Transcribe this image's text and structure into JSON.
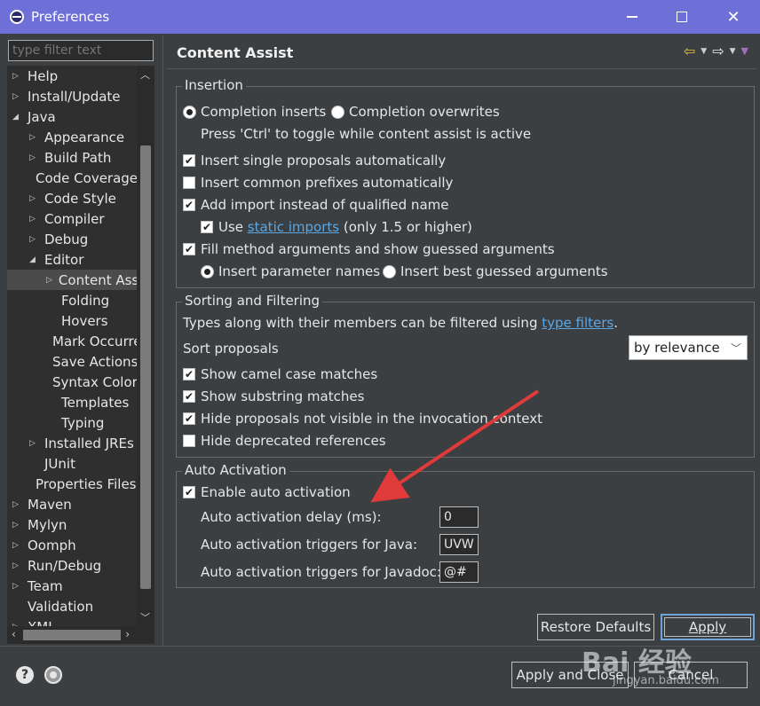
{
  "window": {
    "title": "Preferences"
  },
  "sidebar": {
    "filter_placeholder": "type filter text",
    "items": [
      {
        "label": "Help",
        "twisty": "▷"
      },
      {
        "label": "Install/Update",
        "twisty": "▷"
      },
      {
        "label": "Java",
        "twisty": "◢"
      },
      {
        "label": "Appearance",
        "twisty": "▷"
      },
      {
        "label": "Build Path",
        "twisty": "▷"
      },
      {
        "label": "Code Coverage",
        "twisty": ""
      },
      {
        "label": "Code Style",
        "twisty": "▷"
      },
      {
        "label": "Compiler",
        "twisty": "▷"
      },
      {
        "label": "Debug",
        "twisty": "▷"
      },
      {
        "label": "Editor",
        "twisty": "◢"
      },
      {
        "label": "Content Assist",
        "twisty": "▷"
      },
      {
        "label": "Folding",
        "twisty": ""
      },
      {
        "label": "Hovers",
        "twisty": ""
      },
      {
        "label": "Mark Occurrences",
        "twisty": ""
      },
      {
        "label": "Save Actions",
        "twisty": ""
      },
      {
        "label": "Syntax Coloring",
        "twisty": ""
      },
      {
        "label": "Templates",
        "twisty": ""
      },
      {
        "label": "Typing",
        "twisty": ""
      },
      {
        "label": "Installed JREs",
        "twisty": "▷"
      },
      {
        "label": "JUnit",
        "twisty": ""
      },
      {
        "label": "Properties Files Editor",
        "twisty": ""
      },
      {
        "label": "Maven",
        "twisty": "▷"
      },
      {
        "label": "Mylyn",
        "twisty": "▷"
      },
      {
        "label": "Oomph",
        "twisty": "▷"
      },
      {
        "label": "Run/Debug",
        "twisty": "▷"
      },
      {
        "label": "Team",
        "twisty": "▷"
      },
      {
        "label": "Validation",
        "twisty": ""
      },
      {
        "label": "XML",
        "twisty": "▷"
      }
    ]
  },
  "page": {
    "title": "Content Assist"
  },
  "insertion": {
    "title": "Insertion",
    "radio_inserts": "Completion inserts",
    "radio_overwrites": "Completion overwrites",
    "toggle_hint": "Press 'Ctrl' to toggle while content assist is active",
    "insert_single": "Insert single proposals automatically",
    "insert_prefixes": "Insert common prefixes automatically",
    "add_import": "Add import instead of qualified name",
    "use_prefix": "Use ",
    "static_imports_link": "static imports",
    "use_suffix": " (only 1.5 or higher)",
    "fill_method": "Fill method arguments and show guessed arguments",
    "insert_param_names": "Insert parameter names",
    "insert_best_guessed": "Insert best guessed arguments"
  },
  "sorting": {
    "title": "Sorting and Filtering",
    "types_text": "Types along with their members can be filtered using ",
    "type_filters_link": "type filters",
    "types_period": ".",
    "sort_label": "Sort proposals",
    "sort_value": "by relevance",
    "camel_case": "Show camel case matches",
    "substring": "Show substring matches",
    "hide_not_visible": "Hide proposals not visible in the invocation context",
    "hide_deprecated": "Hide deprecated references"
  },
  "auto_activation": {
    "title": "Auto Activation",
    "enable": "Enable auto activation",
    "delay_label": "Auto activation delay (ms):",
    "delay_value": "0",
    "java_label": "Auto activation triggers for Java:",
    "java_value": "UVW",
    "javadoc_label": "Auto activation triggers for Javadoc:",
    "javadoc_value": "@#"
  },
  "buttons": {
    "restore_defaults": "Restore Defaults",
    "apply": "Apply",
    "apply_and_close": "Apply and Close",
    "cancel": "Cancel"
  },
  "watermark": {
    "main": "Bai 经验",
    "sub": "jingyan.baidu.com"
  },
  "colors": {
    "titlebar": "#6f6fd8",
    "background": "#3c3f41",
    "link": "#5aa7e6",
    "annotation_arrow": "#e03a3a"
  }
}
